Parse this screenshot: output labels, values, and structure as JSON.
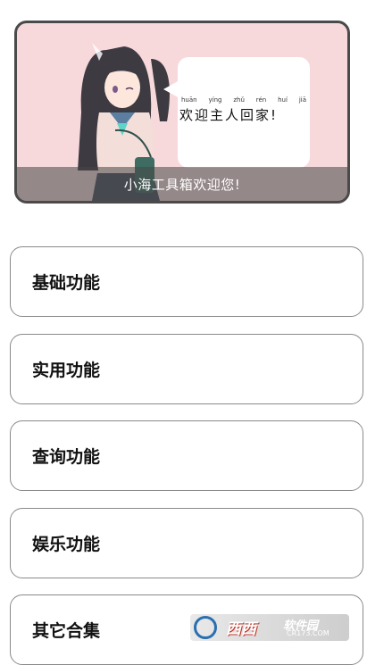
{
  "banner": {
    "pinyin": [
      "huān",
      "yíng",
      "zhǔ",
      "rén",
      "huí",
      "jiā"
    ],
    "greeting": "欢迎主人回家!",
    "caption": "小海工具箱欢迎您!"
  },
  "menu": [
    {
      "label": "基础功能"
    },
    {
      "label": "实用功能"
    },
    {
      "label": "查询功能"
    },
    {
      "label": "娱乐功能"
    },
    {
      "label": "其它合集"
    }
  ],
  "watermark": {
    "brand": "西西",
    "sub": "软件园",
    "url": "CR173.COM"
  },
  "colors": {
    "banner_bg": "#f7d9dc",
    "border": "#8a8a8a"
  }
}
